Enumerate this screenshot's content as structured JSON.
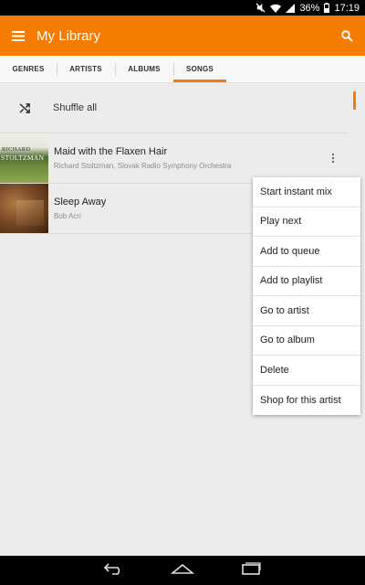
{
  "status_bar": {
    "battery": "36%",
    "time": "17:19"
  },
  "app_bar": {
    "title": "My Library"
  },
  "tabs": [
    {
      "label": "GENRES",
      "active": false
    },
    {
      "label": "ARTISTS",
      "active": false
    },
    {
      "label": "ALBUMS",
      "active": false
    },
    {
      "label": "SONGS",
      "active": true
    }
  ],
  "shuffle": {
    "label": "Shuffle all"
  },
  "songs": [
    {
      "title": "Maid with the Flaxen Hair",
      "artist": "Richard Stoltzman, Slovak Radio Symphony Orchestra",
      "art_text_top": "RICHARD",
      "art_text_bottom": "STOLTZMAN"
    },
    {
      "title": "Sleep Away",
      "artist": "Bob Acri"
    }
  ],
  "context_menu": {
    "items": [
      "Start instant mix",
      "Play next",
      "Add to queue",
      "Add to playlist",
      "Go to artist",
      "Go to album",
      "Delete",
      "Shop for this artist"
    ]
  },
  "colors": {
    "accent": "#f57c00",
    "background": "#ececec"
  },
  "icons": [
    "wifi-icon",
    "signal-icon",
    "battery-icon",
    "menu-icon",
    "search-icon",
    "shuffle-icon",
    "overflow-menu-icon",
    "back-icon",
    "home-icon",
    "recents-icon"
  ]
}
